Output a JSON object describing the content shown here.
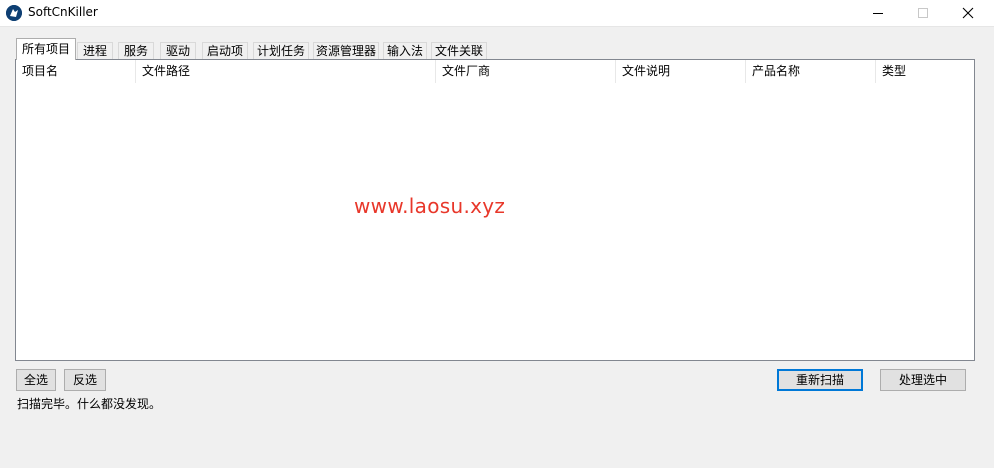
{
  "window": {
    "title": "SoftCnKiller"
  },
  "tabs": [
    {
      "label": "所有项目",
      "active": true
    },
    {
      "label": "进程",
      "active": false
    },
    {
      "label": "服务",
      "active": false
    },
    {
      "label": "驱动",
      "active": false
    },
    {
      "label": "启动项",
      "active": false
    },
    {
      "label": "计划任务",
      "active": false
    },
    {
      "label": "资源管理器",
      "active": false
    },
    {
      "label": "输入法",
      "active": false
    },
    {
      "label": "文件关联",
      "active": false
    }
  ],
  "list": {
    "columns": [
      "项目名",
      "文件路径",
      "文件厂商",
      "文件说明",
      "产品名称",
      "类型"
    ],
    "rows": []
  },
  "watermark": "www.laosu.xyz",
  "buttons": {
    "select_all": "全选",
    "invert_selection": "反选",
    "rescan": "重新扫描",
    "process_selected": "处理选中"
  },
  "status": "扫描完毕。什么都没发现。",
  "colors": {
    "watermark": "#e8372a",
    "default_button_border": "#0078d7"
  }
}
